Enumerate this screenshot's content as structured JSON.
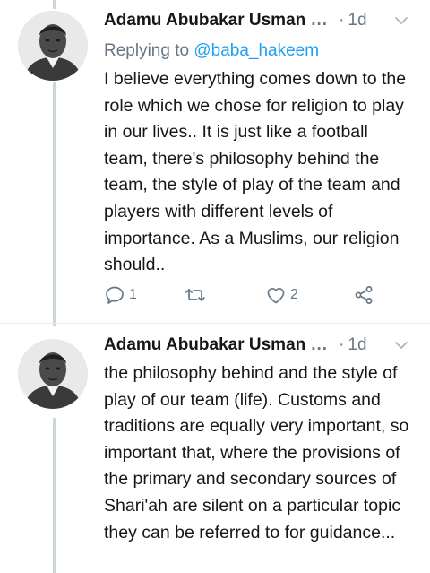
{
  "tweets": [
    {
      "author": "Adamu Abubakar Usman",
      "truncation": "...",
      "separator": "·",
      "time": "1d",
      "replying_prefix": "Replying to",
      "replying_handle": "@baba_hakeem",
      "text": "I believe everything comes down to the role which we chose for religion to play in our lives.. It is just like a football team, there's philosophy behind the team, the style of play of the team and players with different levels of importance. As a Muslims, our religion should..",
      "reply_count": "1",
      "retweet_count": "",
      "like_count": "2"
    },
    {
      "author": "Adamu Abubakar Usman",
      "truncation": "...",
      "separator": "·",
      "time": "1d",
      "text": "the philosophy behind and the style of play of our team (life). Customs and traditions are equally very important, so important that, where the provisions of the primary and secondary sources of Shari'ah are silent on a particular topic they can be referred to for guidance..."
    }
  ],
  "icons": {
    "reply": "reply-icon",
    "retweet": "retweet-icon",
    "like": "heart-icon",
    "share": "share-icon",
    "menu": "chevron-down-icon"
  },
  "colors": {
    "accent": "#1da1f2",
    "muted": "#657786",
    "thread_line": "#ccd6dd"
  }
}
